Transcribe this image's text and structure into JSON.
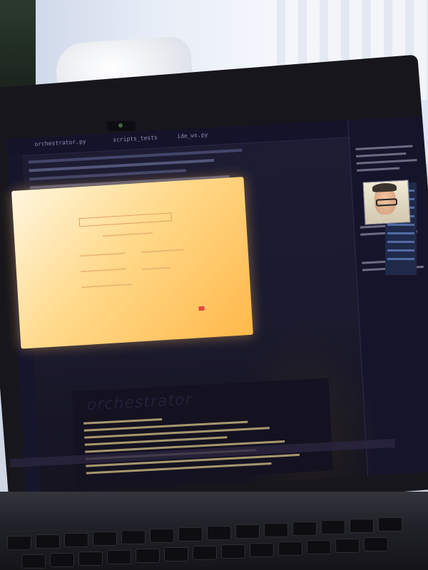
{
  "scene": {
    "description_free": true,
    "accent_color": "#ffb84a",
    "screen_color": "#1b1a2e"
  },
  "editor": {
    "tabs": [
      "orchestrator.py",
      "scripts_tests",
      "ide_ws.py"
    ],
    "active_tab": "orchestrator.py",
    "file_label": "orchestrator.py"
  },
  "terminal": {
    "banner": "orchestrator"
  }
}
